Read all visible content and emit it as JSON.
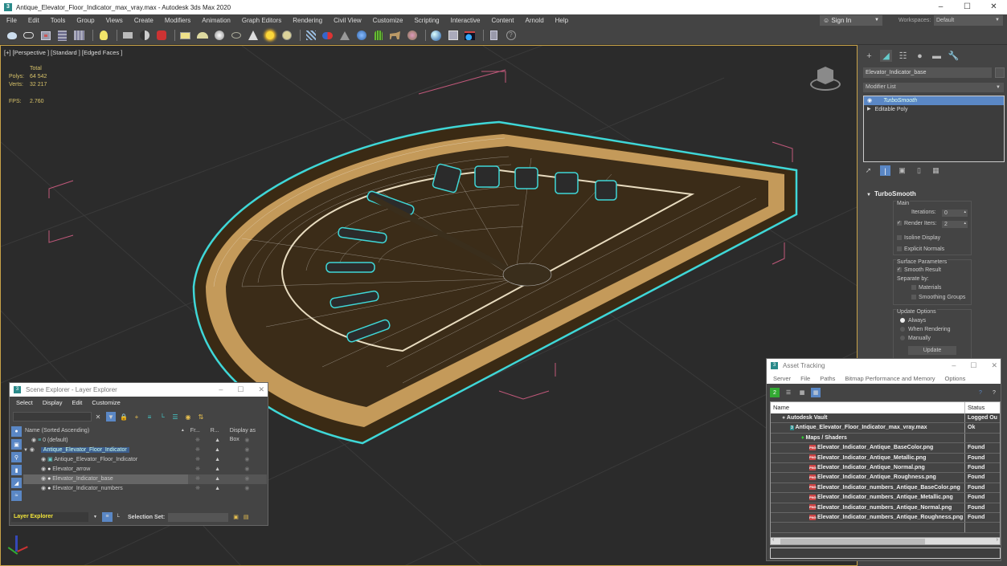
{
  "window": {
    "title": "Antique_Elevator_Floor_Indicator_max_vray.max - Autodesk 3ds Max 2020",
    "app_icon": "3",
    "controls": [
      "minimize-icon",
      "maximize-icon",
      "close-icon"
    ]
  },
  "menubar": {
    "items": [
      "File",
      "Edit",
      "Tools",
      "Group",
      "Views",
      "Create",
      "Modifiers",
      "Animation",
      "Graph Editors",
      "Rendering",
      "Civil View",
      "Customize",
      "Scripting",
      "Interactive",
      "Content",
      "Arnold",
      "Help"
    ],
    "sign_in": "Sign In",
    "workspaces_label": "Workspaces:",
    "workspace": "Default"
  },
  "toolbar": {
    "icons": [
      "teapot-icon",
      "cloud-icon",
      "render-frame-icon",
      "layers-icon",
      "table-icon",
      "light-icon",
      "camera-icon",
      "sphere-half-icon",
      "robot-icon",
      "plane-icon",
      "dome-icon",
      "sphere-icon",
      "teapot2-icon",
      "cone-icon",
      "sun-light-icon",
      "disc-light-icon",
      "particles-icon",
      "molecule-icon",
      "pyramid-icon",
      "globe-icon",
      "grass-icon",
      "animal-icon",
      "texture-icon",
      "material-ball-icon",
      "material-editor-icon",
      "render-setup-icon",
      "clipboard-icon",
      "help-icon"
    ]
  },
  "viewport": {
    "label": "[+] [Perspective ] [Standard ] [Edged Faces ]",
    "stats": {
      "header": "Total",
      "polys_label": "Polys:",
      "polys": "64 542",
      "verts_label": "Verts:",
      "verts": "32 217",
      "fps_label": "FPS:",
      "fps": "2.760"
    }
  },
  "command_panel": {
    "tabs": [
      "create-icon",
      "modify-icon",
      "hierarchy-icon",
      "motion-icon",
      "display-icon",
      "utilities-icon"
    ],
    "object_name": "Elevator_Indicator_base",
    "modifier_list": "Modifier List",
    "stack": [
      {
        "label": "TurboSmooth",
        "selected": true
      },
      {
        "label": "Editable Poly",
        "selected": false
      }
    ],
    "turbosmooth": {
      "title": "TurboSmooth",
      "main_label": "Main",
      "iterations_label": "Iterations:",
      "iterations": "0",
      "render_iters_label": "Render Iters:",
      "render_iters": "2",
      "render_iters_checked": true,
      "isoline_display": "Isoline Display",
      "explicit_normals": "Explicit Normals",
      "surface_params": "Surface Parameters",
      "smooth_result": "Smooth Result",
      "separate_by": "Separate by:",
      "materials": "Materials",
      "smoothing_groups": "Smoothing Groups",
      "update_options": "Update Options",
      "always": "Always",
      "when_rendering": "When Rendering",
      "manually": "Manually",
      "update_btn": "Update"
    }
  },
  "scene_explorer": {
    "title": "Scene Explorer - Layer Explorer",
    "menu": [
      "Select",
      "Display",
      "Edit",
      "Customize"
    ],
    "columns": [
      "Name (Sorted Ascending)",
      "Fr...",
      "R...",
      "Display as Box"
    ],
    "rows": [
      {
        "name": "0 (default)",
        "indent": 1,
        "type": "layer"
      },
      {
        "name": "Antique_Elevator_Floor_Indicator",
        "indent": 0,
        "type": "layer-selected"
      },
      {
        "name": "Antique_Elevator_Floor_Indicator",
        "indent": 2,
        "type": "group"
      },
      {
        "name": "Elevator_arrow",
        "indent": 2,
        "type": "object"
      },
      {
        "name": "Elevator_Indicator_base",
        "indent": 2,
        "type": "object-highlight"
      },
      {
        "name": "Elevator_Indicator_numbers",
        "indent": 2,
        "type": "object"
      }
    ],
    "explorer_type": "Layer Explorer",
    "selection_set_label": "Selection Set:"
  },
  "asset_tracking": {
    "title": "Asset Tracking",
    "menu": [
      "Server",
      "File",
      "Paths",
      "Bitmap Performance and Memory",
      "Options"
    ],
    "columns": [
      "Name",
      "Status"
    ],
    "rows": [
      {
        "name": "Autodesk Vault",
        "status": "Logged Ou",
        "indent": 1,
        "icon": "vault-icon"
      },
      {
        "name": "Antique_Elevator_Floor_Indicator_max_vray.max",
        "status": "Ok",
        "indent": 2,
        "icon": "max-file-icon"
      },
      {
        "name": "Maps / Shaders",
        "status": "",
        "indent": 3,
        "icon": "maps-icon"
      },
      {
        "name": "Elevator_Indicator_Antique_BaseColor.png",
        "status": "Found",
        "indent": 4,
        "icon": "png-icon"
      },
      {
        "name": "Elevator_Indicator_Antique_Metallic.png",
        "status": "Found",
        "indent": 4,
        "icon": "png-icon"
      },
      {
        "name": "Elevator_Indicator_Antique_Normal.png",
        "status": "Found",
        "indent": 4,
        "icon": "png-icon"
      },
      {
        "name": "Elevator_Indicator_Antique_Roughness.png",
        "status": "Found",
        "indent": 4,
        "icon": "png-icon"
      },
      {
        "name": "Elevator_Indicator_numbers_Antique_BaseColor.png",
        "status": "Found",
        "indent": 4,
        "icon": "png-icon"
      },
      {
        "name": "Elevator_Indicator_numbers_Antique_Metallic.png",
        "status": "Found",
        "indent": 4,
        "icon": "png-icon"
      },
      {
        "name": "Elevator_Indicator_numbers_Antique_Normal.png",
        "status": "Found",
        "indent": 4,
        "icon": "png-icon"
      },
      {
        "name": "Elevator_Indicator_numbers_Antique_Roughness.png",
        "status": "Found",
        "indent": 4,
        "icon": "png-icon"
      }
    ]
  },
  "colors": {
    "accent": "#5a87c5",
    "selection_outline": "#3fd7d7",
    "viewport_bg": "#2b2b2b",
    "stats_text": "#d8c36a",
    "layer_explorer_text": "#f2e53a"
  }
}
